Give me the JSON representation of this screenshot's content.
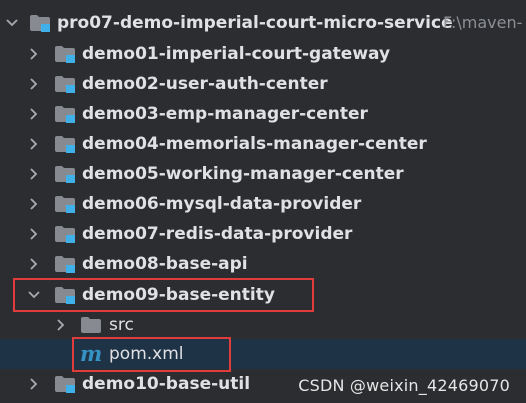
{
  "project": {
    "root_label": "pro07-demo-imperial-court-micro-service",
    "root_path": "F:\\maven-"
  },
  "modules": [
    {
      "label": "demo01-imperial-court-gateway"
    },
    {
      "label": "demo02-user-auth-center"
    },
    {
      "label": "demo03-emp-manager-center"
    },
    {
      "label": "demo04-memorials-manager-center"
    },
    {
      "label": "demo05-working-manager-center"
    },
    {
      "label": "demo06-mysql-data-provider"
    },
    {
      "label": "demo07-redis-data-provider"
    },
    {
      "label": "demo08-base-api"
    },
    {
      "label": "demo09-base-entity"
    },
    {
      "label": "demo10-base-util"
    }
  ],
  "expanded_module": {
    "src_label": "src",
    "pom_label": "pom.xml",
    "pom_icon_glyph": "m"
  },
  "watermark": "CSDN @weixin_42469070",
  "colors": {
    "background": "#2b2d30",
    "selected_row": "#1f3346",
    "highlight_border": "#e03c3c",
    "module_badge": "#3fb1e8",
    "maven_icon": "#3592c4"
  }
}
